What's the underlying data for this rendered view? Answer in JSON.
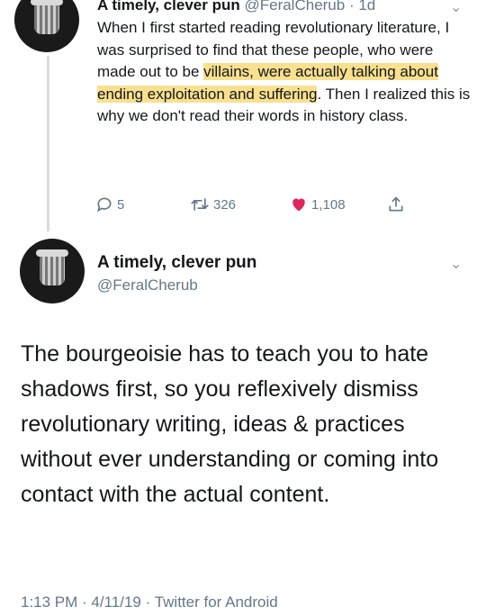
{
  "tweet1": {
    "name": "A timely, clever pun",
    "handle": "@FeralCherub",
    "time_sep": " · ",
    "time": "1d",
    "text_before_highlight": "When I first started reading revolutionary literature, I was surprised to find that these people, who were made out to be ",
    "text_highlight": "villains, were actually talking about ending exploitation and suffering",
    "text_after_highlight": ". Then I realized this is why we don't read their words in history class.",
    "replies": "5",
    "retweets": "326",
    "likes": "1,108",
    "highlight_color": "#f8e08e",
    "like_color": "#e0245e"
  },
  "tweet2": {
    "name": "A timely, clever pun",
    "handle": "@FeralCherub",
    "text": "The bourgeoisie has to teach you to hate shadows first, so you reflexively dismiss revolutionary writing, ideas & practices without ever understanding or coming into contact with the actual content.",
    "time": "1:13 PM",
    "sep1": " · ",
    "date": "4/11/19",
    "sep2": " · ",
    "source": "Twitter for Android"
  },
  "icons": {
    "reply": "reply-icon",
    "retweet": "retweet-icon",
    "like": "heart-icon",
    "share": "share-icon",
    "menu": "chevron-down-icon"
  }
}
